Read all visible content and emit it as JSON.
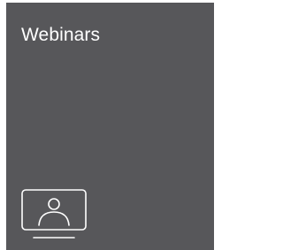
{
  "tile": {
    "title": "Webinars",
    "icon": "webinar-presenter-screen-icon",
    "background_color": "#57575a",
    "text_color": "#ffffff"
  }
}
